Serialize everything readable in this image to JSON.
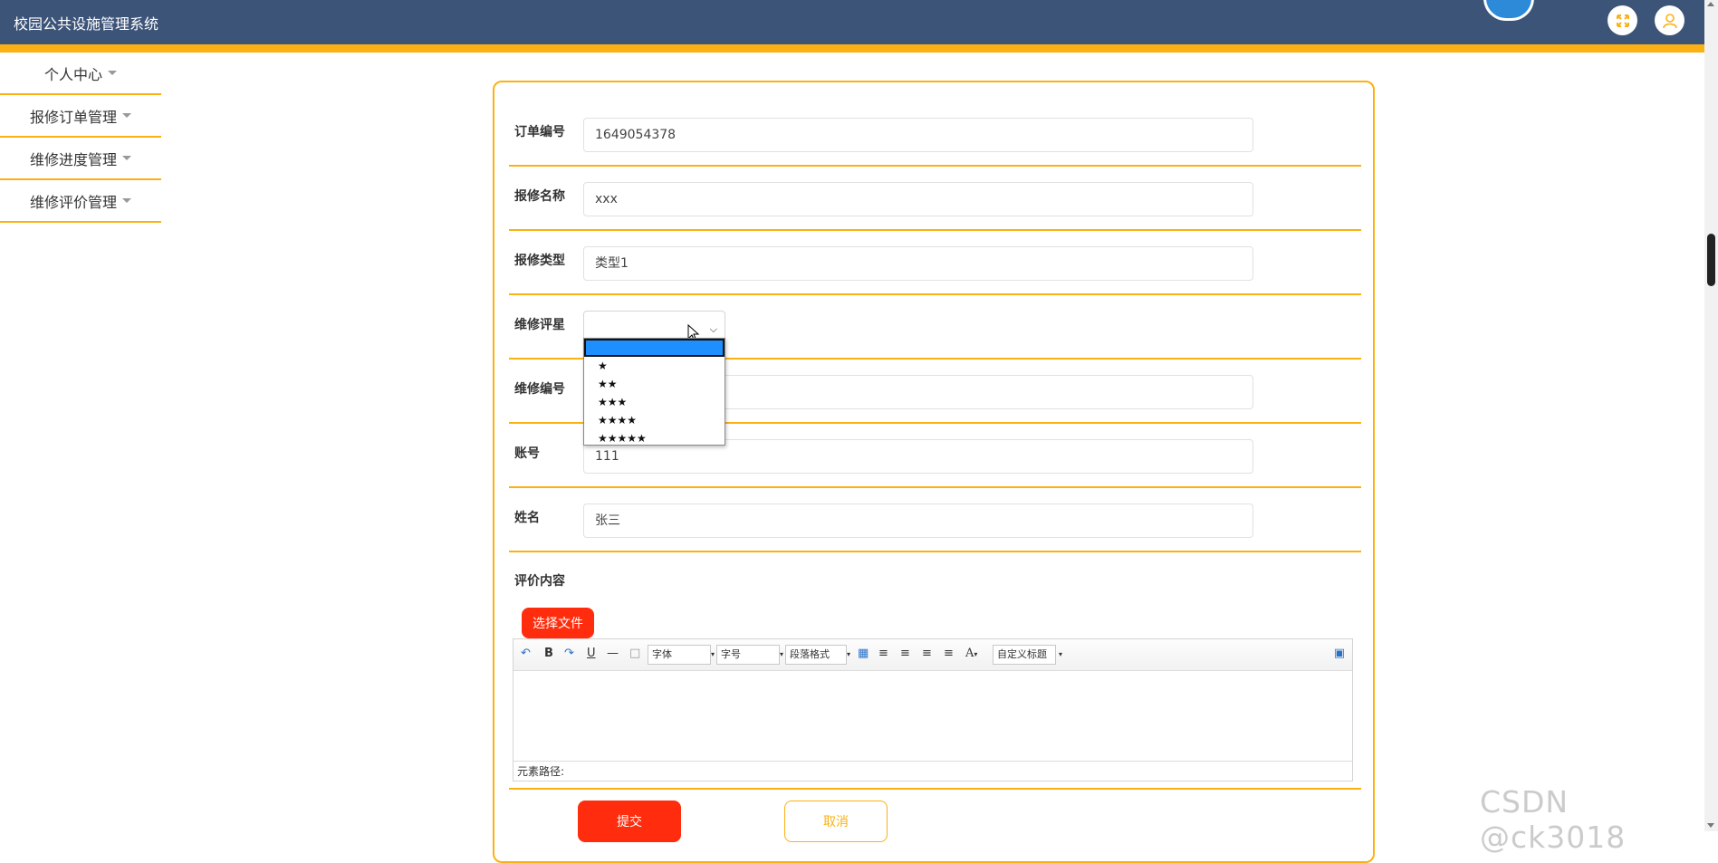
{
  "header": {
    "title": "校园公共设施管理系统"
  },
  "sidebar": {
    "items": [
      {
        "label": "个人中心"
      },
      {
        "label": "报修订单管理"
      },
      {
        "label": "维修进度管理"
      },
      {
        "label": "维修评价管理"
      }
    ]
  },
  "form": {
    "order_no": {
      "label": "订单编号",
      "value": "1649054378"
    },
    "repair_name": {
      "label": "报修名称",
      "value": "xxx"
    },
    "repair_type": {
      "label": "报修类型",
      "value": "类型1"
    },
    "rating": {
      "label": "维修评星",
      "value": "",
      "options": [
        "",
        "★",
        "★★",
        "★★★",
        "★★★★",
        "★★★★★"
      ]
    },
    "repair_no": {
      "label": "维修编号",
      "value": ""
    },
    "account": {
      "label": "账号",
      "value": "111"
    },
    "name": {
      "label": "姓名",
      "value": "张三"
    },
    "comment": {
      "label": "评价内容"
    },
    "file_button": "选择文件",
    "editor": {
      "font_label": "字体",
      "size_label": "字号",
      "para_label": "段落格式",
      "custom_label": "自定义标题",
      "path_label": "元素路径:"
    },
    "submit_label": "提交",
    "cancel_label": "取消"
  },
  "watermark": "CSDN @ck3018",
  "colors": {
    "header": "#3d5479",
    "accent": "#fbb114",
    "primary_button": "#ff2d0d"
  }
}
